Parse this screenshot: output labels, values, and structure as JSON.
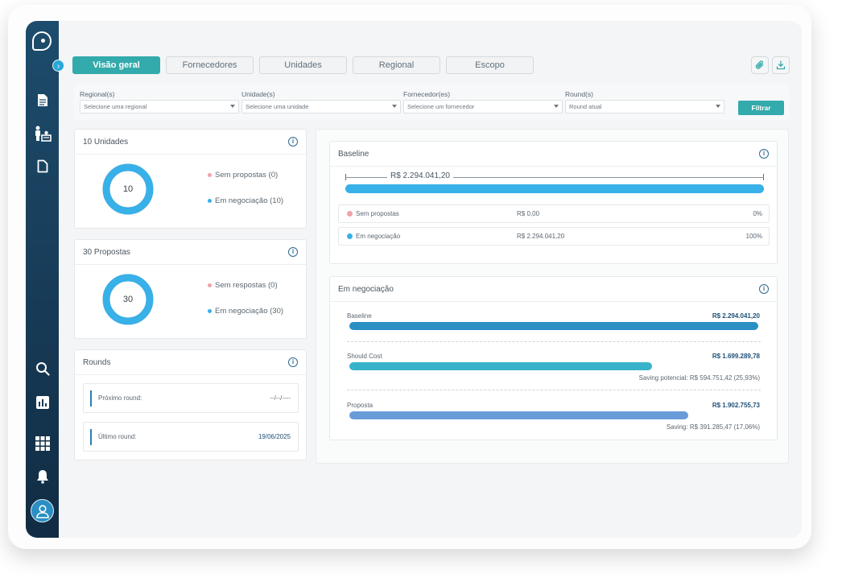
{
  "tabs": [
    {
      "label": "Visão geral",
      "active": true
    },
    {
      "label": "Fornecedores",
      "active": false
    },
    {
      "label": "Unidades",
      "active": false
    },
    {
      "label": "Regional",
      "active": false
    },
    {
      "label": "Escopo",
      "active": false
    }
  ],
  "toolbar": {
    "attach_icon": "paperclip-icon",
    "download_icon": "download-icon"
  },
  "filters": [
    {
      "label": "Regional(s)",
      "placeholder": "Selecione uma regional"
    },
    {
      "label": "Unidade(s)",
      "placeholder": "Selecione uma unidade"
    },
    {
      "label": "Fornecedor(es)",
      "placeholder": "Selecione um fornecedor"
    },
    {
      "label": "Round(s)",
      "placeholder": "Round atual"
    }
  ],
  "filter_button": "Filtrar",
  "units_card": {
    "title": "10 Unidades",
    "center": "10",
    "legend": [
      "Sem propostas (0)",
      "Em negociação (10)"
    ],
    "fraction_em_negociacao": 1.0
  },
  "proposals_card": {
    "title": "30 Propostas",
    "center": "30",
    "legend": [
      "Sem respostas (0)",
      "Em negociação (30)"
    ],
    "fraction_em_negociacao": 1.0
  },
  "rounds_card": {
    "title": "Rounds",
    "rows": [
      {
        "label": "Próximo round:",
        "value": "--/--/----"
      },
      {
        "label": "Último round:",
        "value": "19/06/2025"
      }
    ]
  },
  "baseline_card": {
    "title": "Baseline",
    "total": "R$ 2.294.041,20",
    "rows": [
      {
        "label": "Sem propostas",
        "value": "R$ 0,00",
        "pct": "0%"
      },
      {
        "label": "Em negociação",
        "value": "R$ 2.294.041,20",
        "pct": "100%"
      }
    ]
  },
  "negotiation_card": {
    "title": "Em negociação",
    "bars": [
      {
        "label": "Baseline",
        "value": "R$ 2.294.041,20",
        "fraction": 1.0,
        "sub": ""
      },
      {
        "label": "Should Cost",
        "value": "R$ 1.699.289,78",
        "fraction": 0.7408,
        "sub": "Saving potencial: R$ 594.751,42 (25,93%)"
      },
      {
        "label": "Proposta",
        "value": "R$ 1.902.755,73",
        "fraction": 0.8294,
        "sub": "Saving: R$ 391.285,47 (17,06%)"
      }
    ]
  },
  "colors": {
    "accent": "#33aaab",
    "blue": "#38b0e8",
    "pink": "#f0a3a8",
    "bar_baseline": "#2a8fc3",
    "bar_should": "#36b3c9",
    "bar_proposta": "#6a9bd9"
  },
  "sidebar_icons": [
    "document-icon",
    "org-chart-icon",
    "file-icon",
    "search-icon",
    "chart-icon",
    "apps-grid-icon",
    "bell-icon",
    "user-icon"
  ]
}
